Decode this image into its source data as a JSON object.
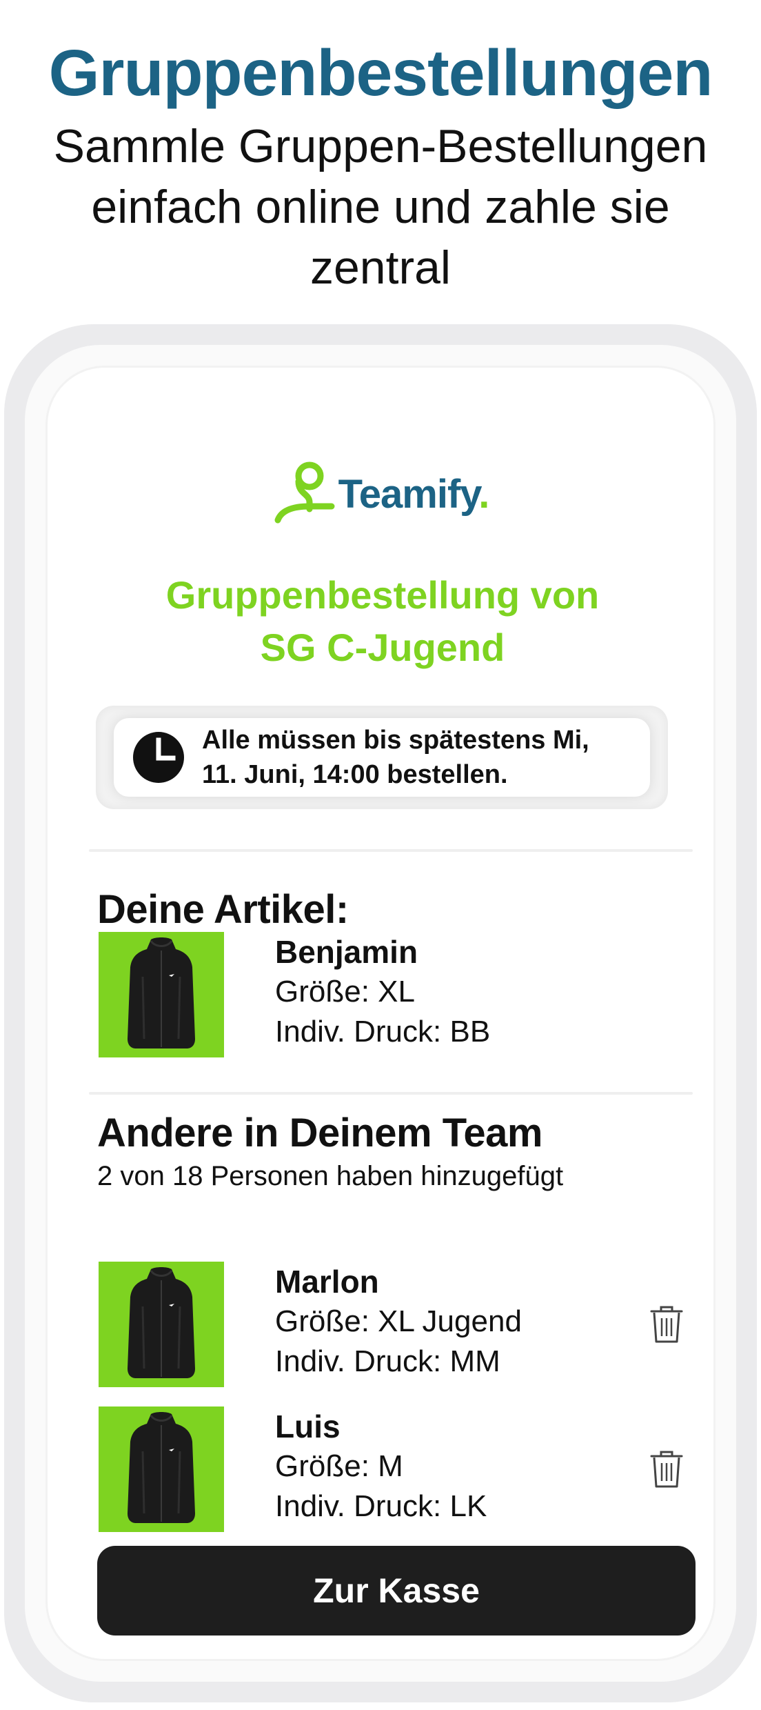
{
  "header": {
    "headline": "Gruppenbestellungen",
    "subline": "Sammle Gruppen-Bestellungen einfach online und zahle sie zentral"
  },
  "app": {
    "logo_text": "Teamify",
    "logo_dot": ".",
    "order_title_line1": "Gruppenbestellung von",
    "order_title_line2": "SG C-Jugend",
    "deadline_line1": "Alle müssen bis spätestens Mi,",
    "deadline_line2": "11. Juni, 14:00 bestellen.",
    "my_items_title": "Deine Artikel:",
    "my_items": [
      {
        "name": "Benjamin",
        "size": "Größe: XL",
        "print": "Indiv. Druck: BB"
      }
    ],
    "team_title": "Andere in Deinem Team",
    "team_subtitle": "2 von 18 Personen haben hinzugefügt",
    "team_items": [
      {
        "name": "Marlon",
        "size": "Größe: XL Jugend",
        "print": "Indiv. Druck: MM"
      },
      {
        "name": "Luis",
        "size": "Größe: M",
        "print": "Indiv. Druck: LK"
      }
    ],
    "checkout_label": "Zur Kasse"
  },
  "colors": {
    "headline_blue": "#1c6385",
    "brand_green": "#7ed321",
    "button_dark": "#1e1e1e"
  },
  "icons": {
    "clock": "clock-icon",
    "trash": "trash-icon",
    "jacket": "jacket-icon",
    "logo": "teamify-logo-icon"
  }
}
